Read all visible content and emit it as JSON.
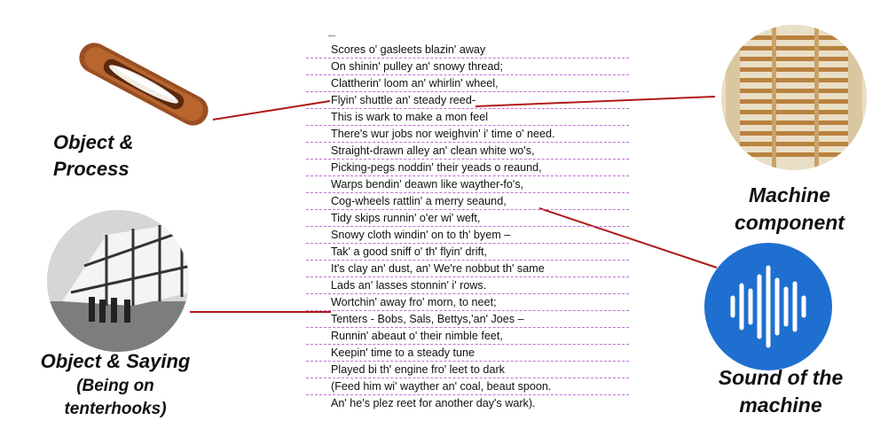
{
  "poem_lines": [
    "Scores o' gasleets blazin' away",
    "On shinin' pulley an' snowy thread;",
    "Clattherin' loom an' whirlin' wheel,",
    "Flyin' shuttle an' steady reed-",
    "This is wark to make a mon feel",
    "There's wur jobs nor weighvin' i' time o' need.",
    "Straight-drawn alley an' clean white wo's,",
    "Picking-pegs noddin' their yeads o reaund,",
    "Warps bendin' deawn like wayther-fo's,",
    "Cog-wheels rattlin' a merry seaund,",
    "Tidy skips runnin' o'er wi' weft,",
    "Snowy cloth windin' on to th' byem –",
    "Tak' a good sniff o' th' flyin' drift,",
    "It's clay an' dust, an' We're nobbut th' same",
    "Lads an' lasses stonnin' i' rows.",
    "Wortchin' away fro' morn, to neet;",
    "Tenters - Bobs, Sals, Bettys,'an' Joes –",
    "Runnin' abeaut o' their nimble feet,",
    "Keepin' time to a steady tune",
    "Played bi th' engine fro' leet to dark",
    "(Feed him wi' wayther an' coal, beaut spoon.",
    "An' he's plez reet for another day's wark)."
  ],
  "labels": {
    "object_process_1": "Object &",
    "object_process_2": "Process",
    "machine_component_1": "Machine",
    "machine_component_2": "component",
    "object_saying_1": "Object & Saying",
    "object_saying_2": "(Being on",
    "object_saying_3": "tenterhooks)",
    "sound_1": "Sound of the",
    "sound_2": "machine"
  },
  "icons": {
    "top_left": "wooden-shuttle-photo",
    "top_right": "reed-comb-photo",
    "bottom_left": "tenter-frame-photo",
    "bottom_right": "sound-wave-icon"
  },
  "colors": {
    "pink_highlight": "#f3b6ee",
    "blue_highlight": "#bcd6f2",
    "yellow_highlight": "#ffe59a",
    "connector_line": "#b01818",
    "sound_icon_bg": "#1f6fd0"
  }
}
